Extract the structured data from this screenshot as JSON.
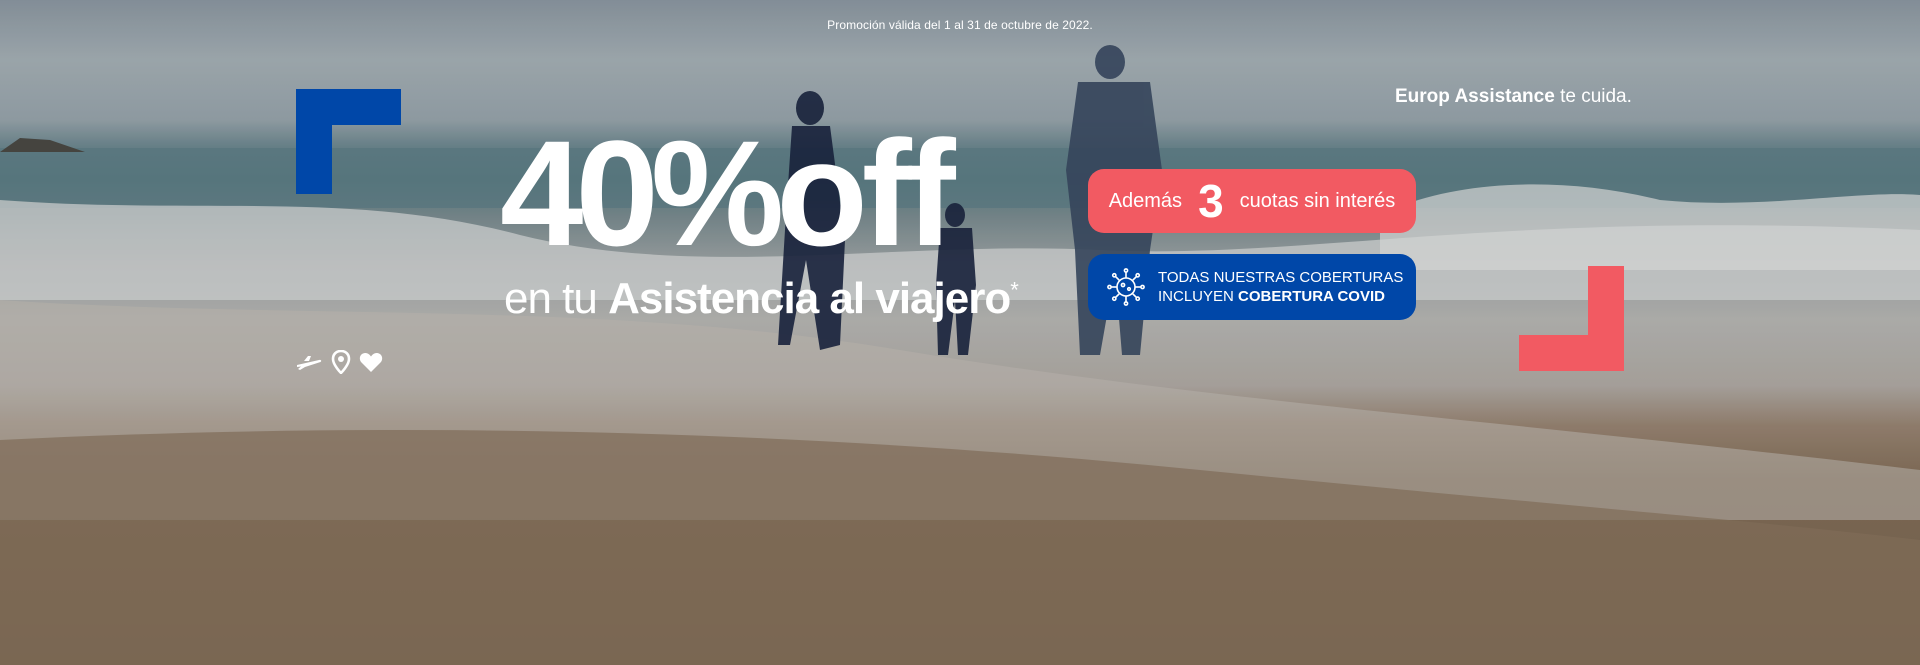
{
  "promo": {
    "validity": "Promoción válida del 1 al 31 de octubre de 2022."
  },
  "brand": {
    "name": "Europ Assistance",
    "tagline": " te cuida."
  },
  "headline": {
    "percent": "40%",
    "off": "off",
    "sub_prefix": "en tu ",
    "sub_strong": "Asistencia al viajero",
    "sub_star": "*"
  },
  "installments": {
    "prefix": "Además",
    "number": "3",
    "suffix": "cuotas sin interés"
  },
  "covid": {
    "line1": "TODAS NUESTRAS COBERTURAS",
    "line2_prefix": "INCLUYEN ",
    "line2_strong": "COBERTURA COVID",
    "icon": "virus-icon"
  },
  "travel_icons": [
    "airplane-icon",
    "location-pin-icon",
    "heart-icon"
  ],
  "colors": {
    "accent_blue": "#0047a8",
    "accent_red": "#f25a62",
    "text": "#ffffff"
  }
}
